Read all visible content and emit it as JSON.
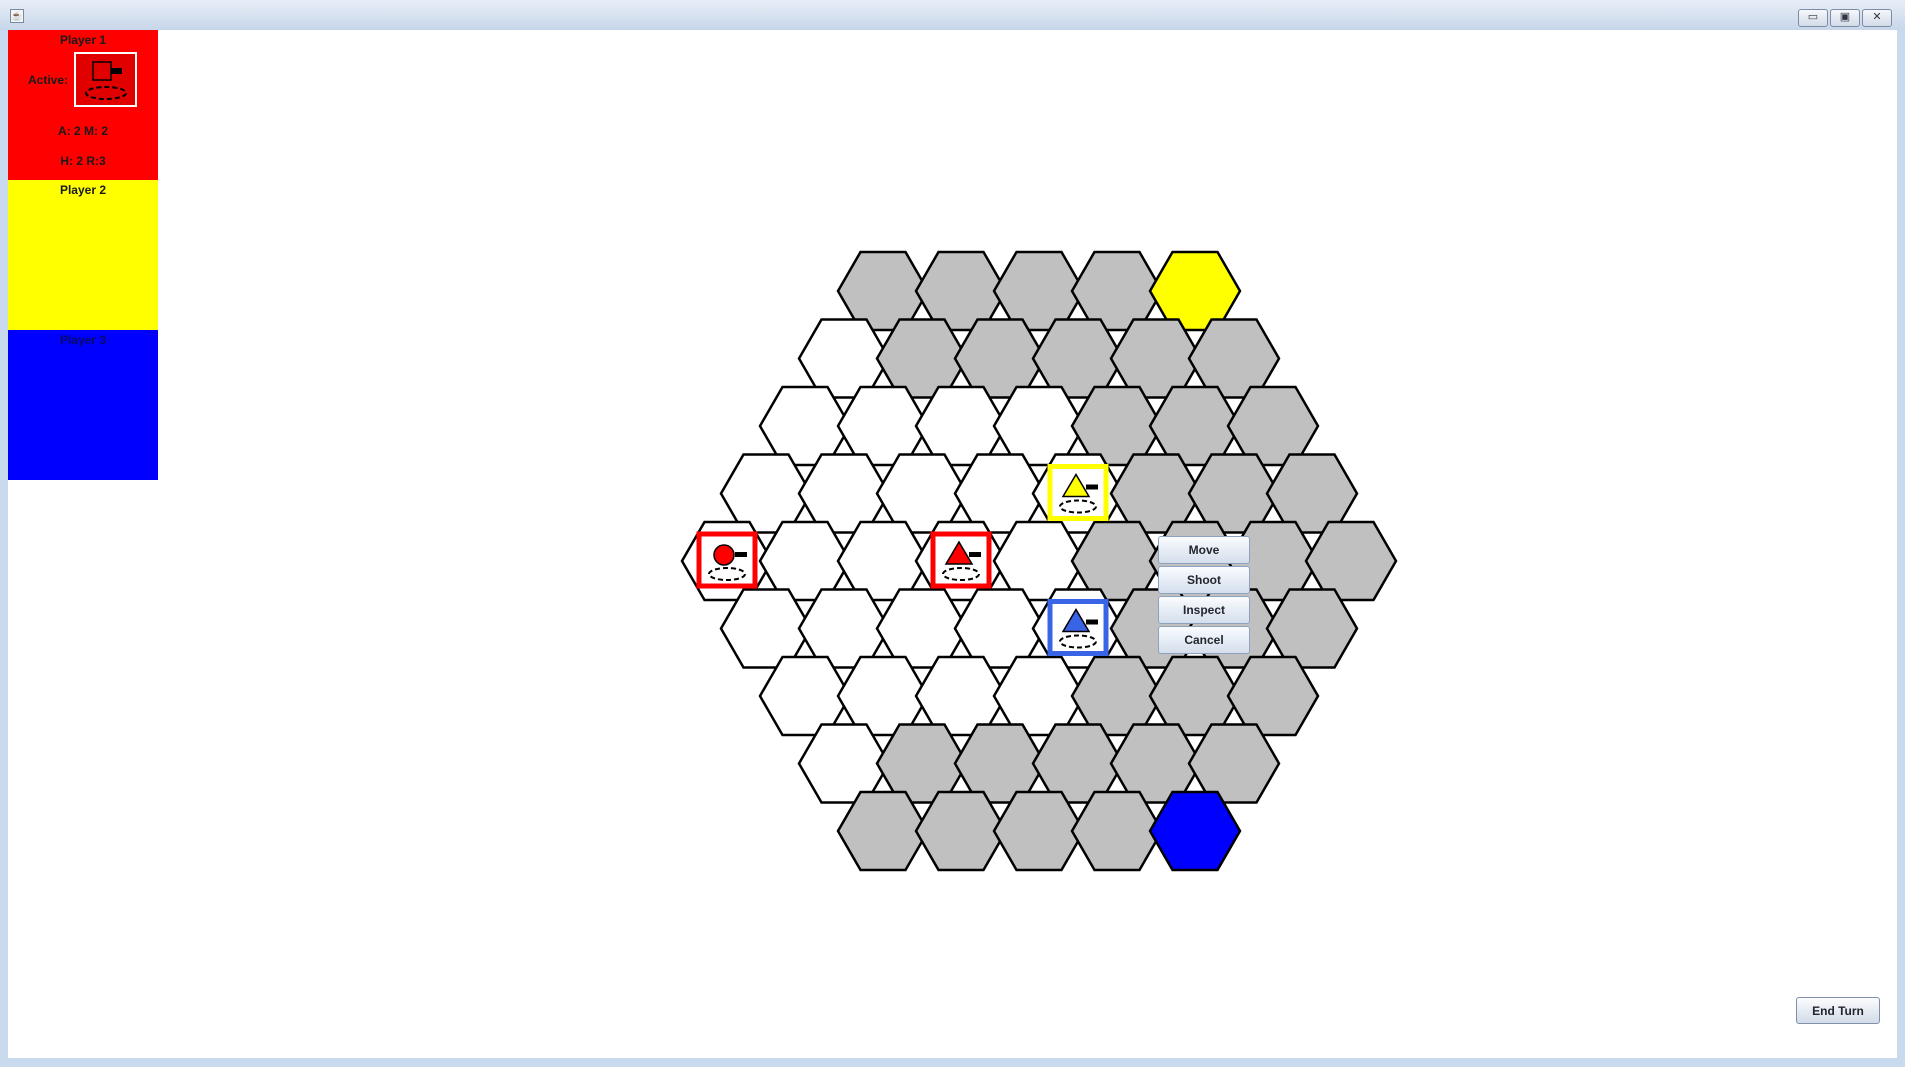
{
  "window": {
    "app_icon": "java-cup-icon",
    "controls": {
      "minimize": "▭",
      "maximize": "▣",
      "close": "✕"
    }
  },
  "players": [
    {
      "name": "Player 1",
      "color": "#ff0000",
      "title_color": "#1a1a1a"
    },
    {
      "name": "Player 2",
      "color": "#ffff00",
      "title_color": "#1a1a1a"
    },
    {
      "name": "Player 3",
      "color": "#0000ff",
      "title_color": "#0a0a55"
    }
  ],
  "active_unit": {
    "label": "Active:",
    "stats_line1": "A: 2  M: 2",
    "stats_line2": "H: 2  R:3"
  },
  "board": {
    "colors": {
      "empty": "#ffffff",
      "gray": "#c0c0c0",
      "yellow": "#ffff00",
      "blue": "#0000ff",
      "outline": "#000000"
    },
    "rows": [
      [
        "gray",
        "gray",
        "gray",
        "gray",
        "yellow"
      ],
      [
        "white",
        "gray",
        "gray",
        "gray",
        "gray",
        "gray"
      ],
      [
        "white",
        "white",
        "white",
        "white",
        "gray",
        "gray",
        "gray"
      ],
      [
        "white",
        "white",
        "white",
        "white",
        "white",
        "gray",
        "gray",
        "gray"
      ],
      [
        "white",
        "white",
        "white",
        "white",
        "white",
        "gray",
        "gray",
        "gray",
        "gray"
      ],
      [
        "white",
        "white",
        "white",
        "white",
        "white",
        "gray",
        "gray",
        "gray"
      ],
      [
        "white",
        "white",
        "white",
        "white",
        "gray",
        "gray",
        "gray"
      ],
      [
        "white",
        "gray",
        "gray",
        "gray",
        "gray",
        "gray"
      ],
      [
        "gray",
        "gray",
        "gray",
        "gray",
        "blue"
      ]
    ],
    "units": [
      {
        "row": 4,
        "col": 0,
        "shape": "circle",
        "player_color": "#ff0000",
        "frame": "#ff0000"
      },
      {
        "row": 4,
        "col": 3,
        "shape": "triangle",
        "player_color": "#ff0000",
        "frame": "#ff0000"
      },
      {
        "row": 3,
        "col": 4,
        "shape": "triangle",
        "player_color": "#ffff00",
        "frame": "#ffff00"
      },
      {
        "row": 5,
        "col": 4,
        "shape": "triangle",
        "player_color": "#3a64e6",
        "frame": "#3a64e6"
      }
    ]
  },
  "context_menu": {
    "items": [
      "Move",
      "Shoot",
      "Inspect",
      "Cancel"
    ]
  },
  "end_turn_label": "End Turn"
}
